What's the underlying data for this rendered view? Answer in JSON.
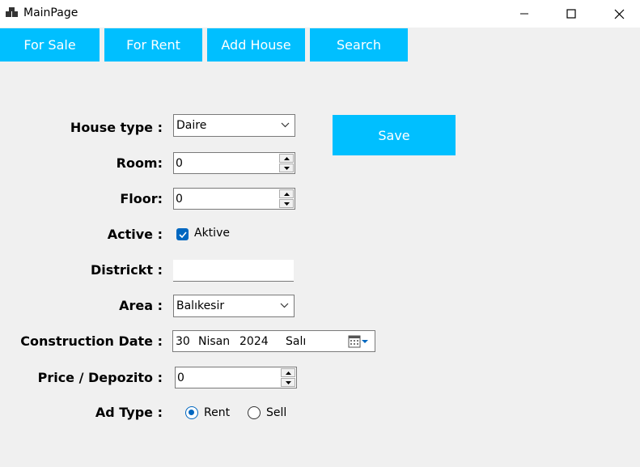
{
  "window": {
    "title": "MainPage",
    "icon": "app-window-icon",
    "controls": [
      "minimize-icon",
      "maximize-icon",
      "close-icon"
    ]
  },
  "nav": {
    "items": [
      {
        "label": "For Sale"
      },
      {
        "label": "For Rent"
      },
      {
        "label": "Add House"
      },
      {
        "label": "Search"
      }
    ]
  },
  "form": {
    "house_type": {
      "label": "House type :",
      "value": "Daire"
    },
    "room": {
      "label": "Room:",
      "value": "0"
    },
    "floor": {
      "label": "Floor:",
      "value": "0"
    },
    "active": {
      "label": "Active :",
      "checkbox_label": "Aktive",
      "checked": true
    },
    "district": {
      "label": "Districkt :",
      "value": ""
    },
    "area": {
      "label": "Area :",
      "value": "Balıkesir"
    },
    "construction_date": {
      "label": "Construction Date :",
      "day": "30",
      "month": "Nisan",
      "year": "2024",
      "weekday": "Salı"
    },
    "price": {
      "label": "Price / Depozito :",
      "value": "0"
    },
    "ad_type": {
      "label": "Ad Type :",
      "options": [
        {
          "label": "Rent",
          "selected": true
        },
        {
          "label": "Sell",
          "selected": false
        }
      ]
    }
  },
  "save_button": {
    "label": "Save"
  },
  "colors": {
    "accent": "#00bfff",
    "background": "#f0f0f0",
    "control_blue": "#0067c0",
    "titlebar": "#ffffff"
  }
}
